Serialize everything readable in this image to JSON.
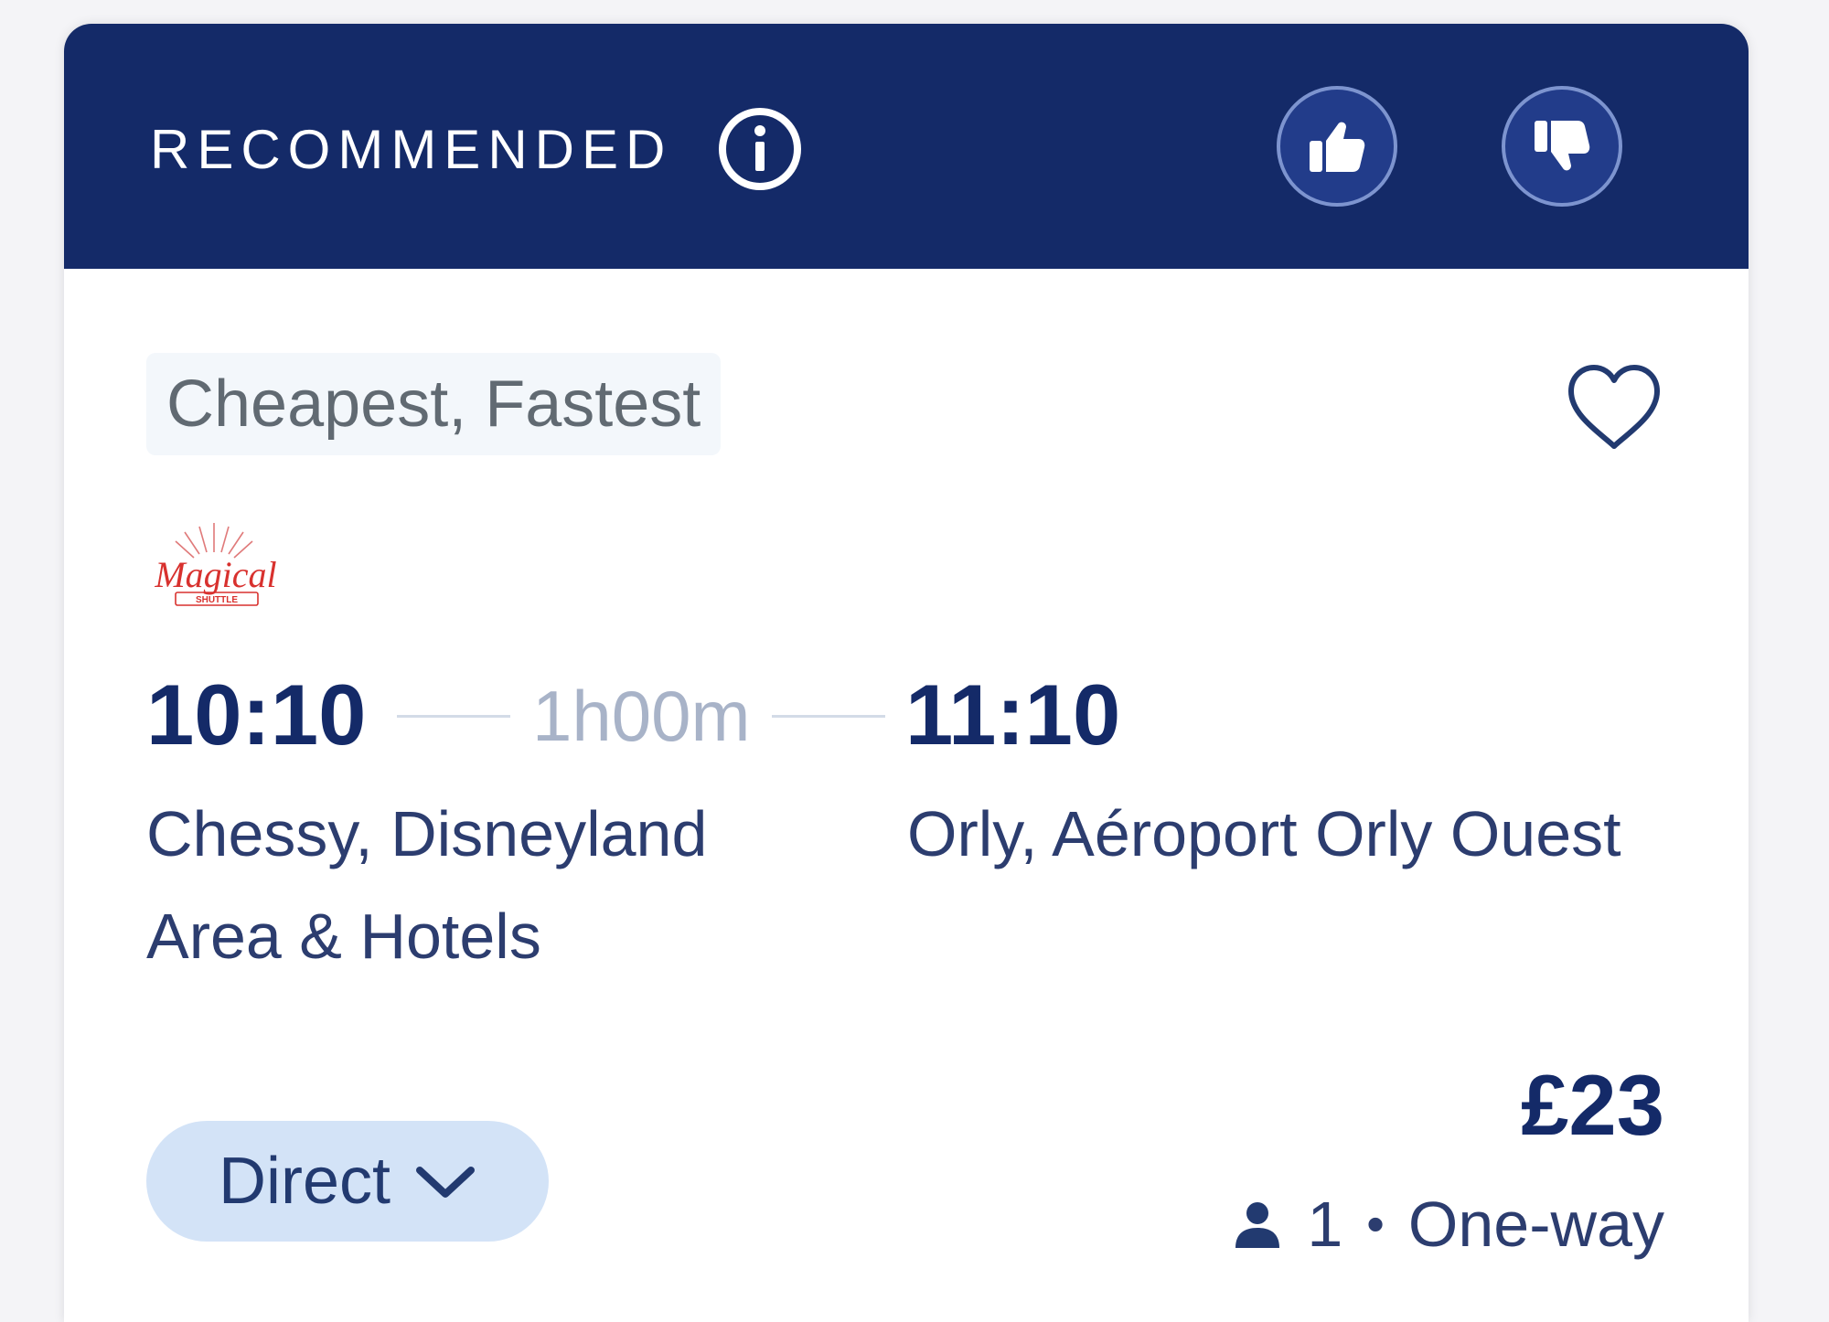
{
  "header": {
    "label": "RECOMMENDED",
    "info_icon": "info-circle-icon",
    "thumbs_up_icon": "thumbs-up-icon",
    "thumbs_down_icon": "thumbs-down-icon",
    "background_color": "#142a68"
  },
  "tag": "Cheapest, Fastest",
  "favorite_icon": "heart-outline-icon",
  "operator": {
    "logo_text": "Magical",
    "logo_subtext": "SHUTTLE"
  },
  "journey": {
    "departure_time": "10:10",
    "duration": "1h00m",
    "arrival_time": "11:10",
    "departure_station": "Chessy, Disneyland Area & Hotels",
    "arrival_station": "Orly, Aéroport Orly Ouest"
  },
  "direct_button": {
    "label": "Direct",
    "icon": "chevron-down-icon"
  },
  "price": "£23",
  "passengers": {
    "icon": "person-icon",
    "count": "1",
    "separator": "•",
    "trip_type": "One-way"
  }
}
